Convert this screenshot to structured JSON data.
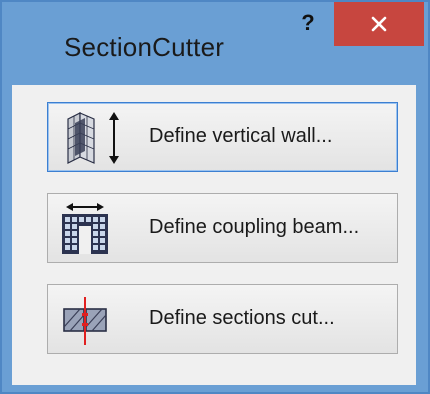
{
  "window": {
    "title": "SectionCutter",
    "help_label": "?",
    "close_label": "close"
  },
  "buttons": [
    {
      "label": "Define vertical wall...",
      "icon": "vertical-wall-icon"
    },
    {
      "label": "Define coupling beam...",
      "icon": "coupling-beam-icon"
    },
    {
      "label": "Define sections cut...",
      "icon": "section-cut-icon"
    }
  ],
  "colors": {
    "titlebar": "#6a9fd4",
    "close_button": "#c7463f",
    "section_line": "#e02020"
  }
}
